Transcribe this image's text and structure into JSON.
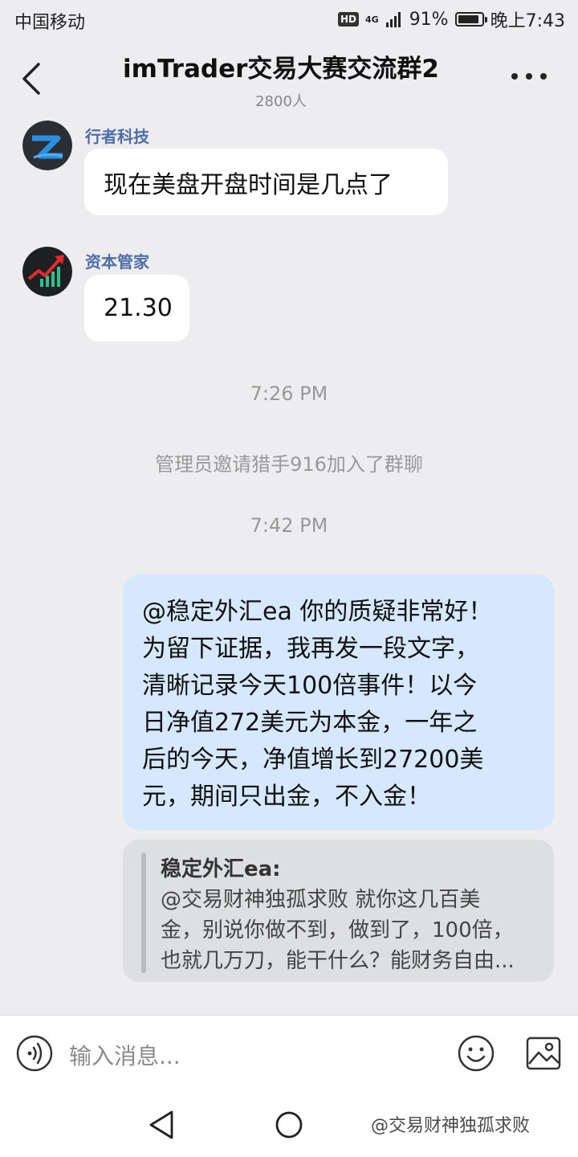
{
  "status_bar": {
    "carrier": "中国移动",
    "hd": "HD",
    "network": "4G",
    "battery_percent": "91%",
    "battery_level": 0.91,
    "time": "晚上7:43"
  },
  "header": {
    "title": "imTrader交易大赛交流群2",
    "member_count": "2800人"
  },
  "messages": [
    {
      "sender": "行者科技",
      "text": "现在美盘开盘时间是几点了"
    },
    {
      "sender": "资本管家",
      "text": "21.30"
    }
  ],
  "timestamps": [
    "7:26 PM",
    "7:42 PM"
  ],
  "system_notice": "管理员邀请猎手916加入了群聊",
  "my_message": {
    "lines": [
      "@稳定外汇ea 你的质疑非常好！",
      "为留下证据，我再发一段文字，",
      "清晰记录今天100倍事件！以今",
      "日净值272美元为本金，一年之",
      "后的今天，净值增长到27200美",
      "元，期间只出金，不入金！"
    ]
  },
  "quote": {
    "author": "稳定外汇ea:",
    "lines": [
      "@交易财神独孤求败 就你这几百美",
      "金，别说你做不到，做到了，100倍，",
      "也就几万刀，能干什么？能财务自由..."
    ]
  },
  "input": {
    "placeholder": "输入消息..."
  },
  "watermark": "@交易财神独孤求败",
  "colors": {
    "background": "#ededf0",
    "sender_name": "#4d6ea8",
    "my_bubble": "#d6e8fd"
  }
}
